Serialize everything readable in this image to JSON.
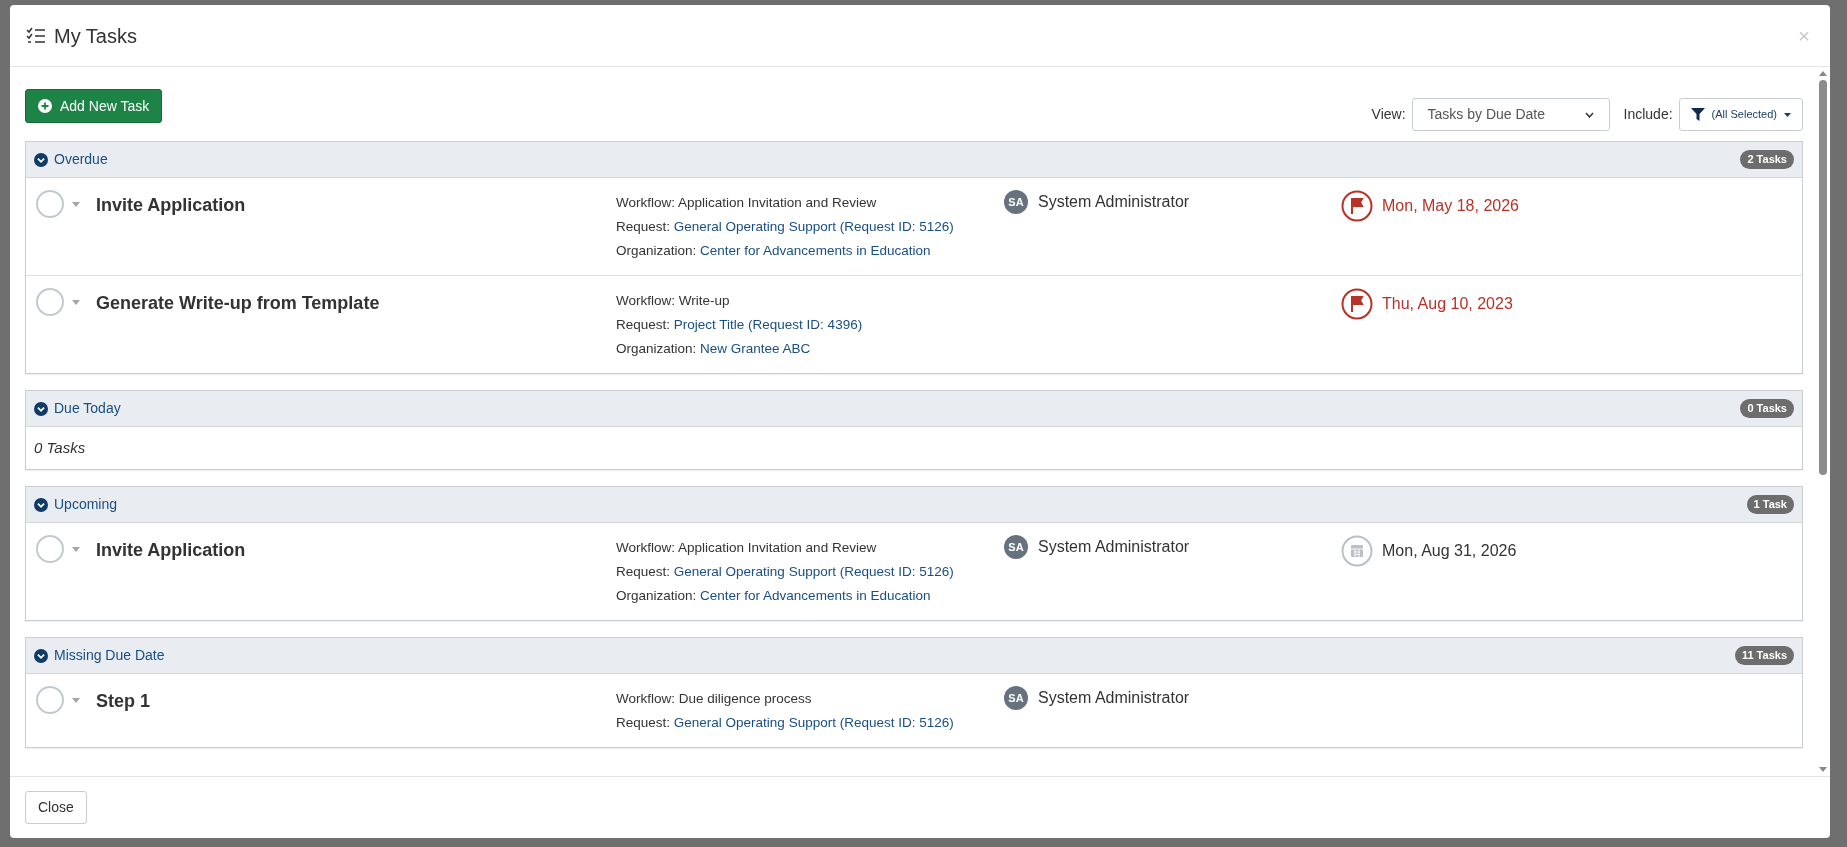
{
  "dialog": {
    "title": "My Tasks",
    "close_symbol": "×"
  },
  "toolbar": {
    "add_button": "Add New Task",
    "view_label": "View:",
    "view_value": "Tasks by Due Date",
    "include_label": "Include:",
    "include_value": "(All Selected)"
  },
  "sections": [
    {
      "title": "Overdue",
      "count": "2 Tasks",
      "expanded": true,
      "tasks": [
        {
          "title": "Invite Application",
          "workflow_label": "Workflow:",
          "workflow": "Application Invitation and Review",
          "request_label": "Request:",
          "request": "General Operating Support (Request ID: 5126)",
          "organization_label": "Organization:",
          "organization": "Center for Advancements in Education",
          "assignee": {
            "initials": "SA",
            "name": "System Administrator"
          },
          "due": {
            "overdue": true,
            "date": "Mon, May 18, 2026"
          }
        },
        {
          "title": "Generate Write-up from Template",
          "workflow_label": "Workflow:",
          "workflow": "Write-up",
          "request_label": "Request:",
          "request": "Project Title (Request ID: 4396)",
          "organization_label": "Organization:",
          "organization": "New Grantee ABC",
          "due": {
            "overdue": true,
            "date": "Thu, Aug 10, 2023"
          }
        }
      ]
    },
    {
      "title": "Due Today",
      "count": "0 Tasks",
      "expanded": true,
      "empty_text": "0 Tasks"
    },
    {
      "title": "Upcoming",
      "count": "1 Task",
      "expanded": true,
      "tasks": [
        {
          "title": "Invite Application",
          "workflow_label": "Workflow:",
          "workflow": "Application Invitation and Review",
          "request_label": "Request:",
          "request": "General Operating Support (Request ID: 5126)",
          "organization_label": "Organization:",
          "organization": "Center for Advancements in Education",
          "assignee": {
            "initials": "SA",
            "name": "System Administrator"
          },
          "due": {
            "overdue": false,
            "date": "Mon, Aug 31, 2026"
          }
        }
      ]
    },
    {
      "title": "Missing Due Date",
      "count": "11 Tasks",
      "expanded": true,
      "tasks": [
        {
          "title": "Step 1",
          "workflow_label": "Workflow:",
          "workflow": "Due diligence process",
          "request_label": "Request:",
          "request": "General Operating Support (Request ID: 5126)",
          "assignee": {
            "initials": "SA",
            "name": "System Administrator"
          }
        }
      ]
    }
  ],
  "footer": {
    "close_button": "Close"
  }
}
